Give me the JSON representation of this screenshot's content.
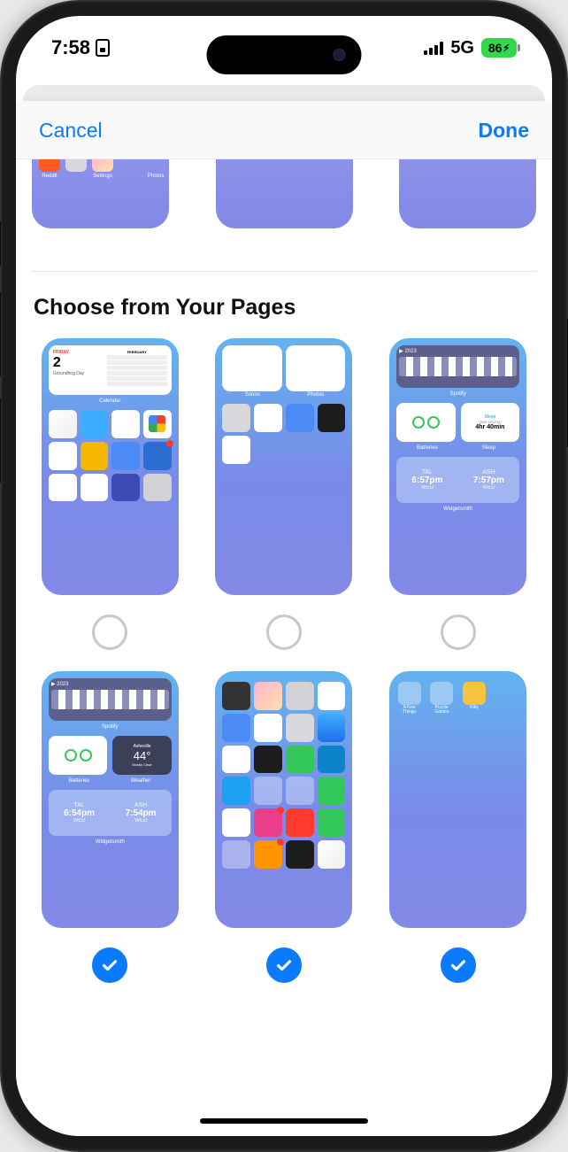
{
  "status": {
    "time": "7:58",
    "network": "5G",
    "battery": "86"
  },
  "header": {
    "cancel": "Cancel",
    "done": "Done"
  },
  "section": {
    "title": "Choose from Your Pages"
  },
  "top_partial": {
    "labels": [
      "Reddit",
      "Settings",
      "Photos"
    ]
  },
  "pages": [
    {
      "selected": false,
      "content": {
        "type": "calendar-home",
        "day_label": "FRIDAY",
        "day_num": "2",
        "event": "Groundhog Day",
        "month": "FEBRUARY",
        "widget_label": "Calendar",
        "apps": [
          "Slack",
          "Mail",
          "Notes",
          "Gmail",
          "Calendar",
          "Amazon",
          "Docs",
          "TheWeatherChannel",
          "Chrome",
          "Reminders",
          "Shortcuts",
          "Contacts"
        ]
      }
    },
    {
      "selected": false,
      "content": {
        "type": "widgets-home",
        "widget_labels": [
          "Sonos",
          "Photos"
        ],
        "apps": [
          "Settings",
          "Notes",
          "Weather",
          "Clock",
          "Calendar"
        ]
      }
    },
    {
      "selected": false,
      "content": {
        "type": "widgets-stack",
        "spotify_label": "Spotify",
        "year": "2023",
        "batt_label": "Batteries",
        "sleep_title": "Sleep",
        "sleep_sub": "TIME ASLEEP",
        "sleep_val": "4hr 40min",
        "sleep_wlabel": "Sleep",
        "ws": {
          "left_name": "TAL",
          "left_time": "6:57pm",
          "right_name": "ASH",
          "right_time": "7:57pm",
          "day": "WED"
        },
        "ws_label": "Widgetsmith"
      }
    },
    {
      "selected": true,
      "content": {
        "type": "widgets-weather",
        "spotify_label": "Spotify",
        "year": "2023",
        "batt_label": "Batteries",
        "weather_city": "Asheville",
        "weather_temp": "44°",
        "weather_desc": "Mostly Clear",
        "weather_label": "Weather",
        "ws": {
          "left_name": "TAL",
          "left_time": "6:54pm",
          "right_name": "ASH",
          "right_time": "7:54pm",
          "day": "WED"
        },
        "ws_label": "Widgetsmith"
      }
    },
    {
      "selected": true,
      "content": {
        "type": "app-grid",
        "apps": [
          "Camera",
          "Photos",
          "Contacts",
          "Files",
          "Weather",
          "Notes",
          "Settings",
          "Mail",
          "Calendar",
          "Clock",
          "Maps",
          "Writer",
          "App Store",
          "Apps",
          "Utilities",
          "Find My",
          "Messenger",
          "Instagram",
          "YouTube",
          "FaceTime",
          "Workday",
          "Reddit",
          "TimePage",
          "Slack"
        ]
      }
    },
    {
      "selected": true,
      "content": {
        "type": "sparse",
        "folders": [
          "A Few Things",
          "Puzzle Games"
        ],
        "apps": [
          "Kitty"
        ]
      }
    }
  ],
  "colors": {
    "accent": "#0a7aff",
    "battery": "#32d74b"
  }
}
